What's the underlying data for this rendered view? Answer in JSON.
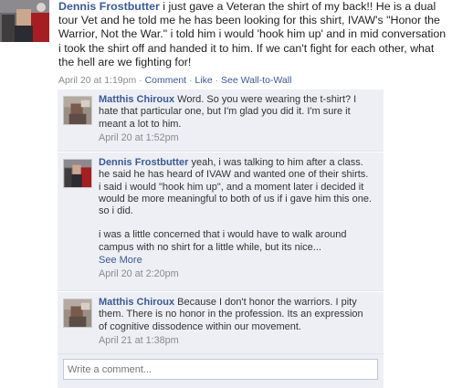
{
  "post": {
    "author": "Dennis Frostbutter",
    "text": " i just gave a Veteran the shirt of my back!! He is a dual tour Vet and he told me he has been looking for this shirt, IVAW's \"Honor the Warrior, Not the War.\" i told him i would 'hook him up' and in mid conversation i took the shirt off and handed it to him. If we can't fight for each other, what the hell are we fighting for!",
    "timestamp": "April 20 at 1:19pm",
    "sep1": " · ",
    "comment_link": "Comment",
    "sep2": " · ",
    "like_link": "Like",
    "sep3": " · ",
    "wall_link": "See Wall-to-Wall"
  },
  "comments": [
    {
      "author": "Matthis Chiroux",
      "text": " Word. So you were wearing the t-shirt? I hate that particular one, but I'm glad you did it. I'm sure it meant a lot to him.",
      "time": "April 20 at 1:52pm"
    },
    {
      "author": "Dennis Frostbutter",
      "text": " yeah, i was talking to him after a class. he said he has heard of IVAW and wanted one of their shirts. i said i would \"hook him up\", and a moment later i decided it would be more meaningful to both of us if i gave him this one. so i did.",
      "text2": "i was a little concerned that i would have to walk around campus with no shirt for a little while, but its nice...",
      "see_more": "See More",
      "time": "April 20 at 2:20pm"
    },
    {
      "author": "Matthis Chiroux",
      "text": " Because I don't honor the warriors. I pity them. There is no honor in the profession. Its an expression of cognitive dissodence within our movement.",
      "time": "April 21 at 1:38pm"
    }
  ],
  "write_comment": {
    "placeholder": "Write a comment..."
  },
  "colors": {
    "link": "#3b5998",
    "comment_bg": "#edeff4",
    "meta_text": "#8a8a8a"
  }
}
